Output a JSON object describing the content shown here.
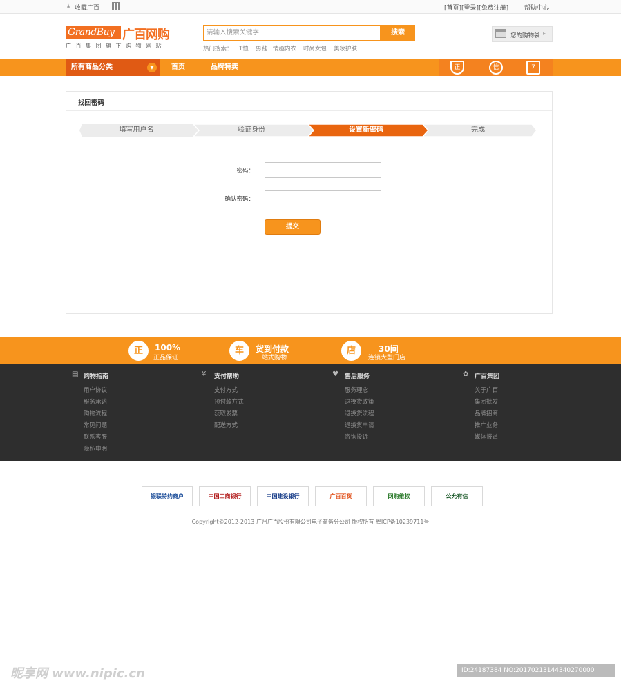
{
  "topbar": {
    "favorite": "收藏广百",
    "links": [
      "[首页]",
      "[登录]",
      "[免费注册]"
    ],
    "help": "帮助中心"
  },
  "logo": {
    "en": "GrandBuy",
    "cn": "广百网购",
    "sub": "广百集团旗下购物网站"
  },
  "search": {
    "placeholder": "请输入搜索关键字",
    "button": "搜索",
    "hot_label": "热门搜索：",
    "hot_terms": [
      "T恤",
      "男鞋",
      "情趣内衣",
      "时尚女包",
      "美妆护肤"
    ]
  },
  "cart": {
    "label": "您的购物袋"
  },
  "nav": {
    "category": "所有商品分类",
    "items": [
      "首页",
      "品牌特卖"
    ],
    "badges": [
      "正",
      "信",
      "7"
    ]
  },
  "panel": {
    "title": "找回密码",
    "steps": [
      "填写用户名",
      "验证身份",
      "设置新密码",
      "完成"
    ],
    "active_step_index": 2,
    "fields": [
      {
        "label": "密码：",
        "value": ""
      },
      {
        "label": "确认密码：",
        "value": ""
      }
    ],
    "submit": "提交"
  },
  "guarantees": [
    {
      "icon": "正",
      "big": "100%",
      "small": "正品保证"
    },
    {
      "icon": "车",
      "big": "货到付款",
      "small": "一站式购物"
    },
    {
      "icon": "店",
      "big": "30间",
      "small": "连锁大型门店"
    }
  ],
  "footer": {
    "columns": [
      {
        "icon": "▤",
        "title": "购物指南",
        "links": [
          "用户协议",
          "服务承诺",
          "购物流程",
          "常见问题",
          "联系客服",
          "隐私申明"
        ]
      },
      {
        "icon": "¥",
        "title": "支付帮助",
        "links": [
          "支付方式",
          "预付款方式",
          "获取发票",
          "配送方式"
        ]
      },
      {
        "icon": "♥",
        "title": "售后服务",
        "links": [
          "服务理念",
          "退换货政策",
          "退换货流程",
          "退换货申请",
          "咨询投诉"
        ]
      },
      {
        "icon": "✿",
        "title": "广百集团",
        "links": [
          "关于广百",
          "集团批发",
          "品牌招商",
          "推广业务",
          "媒体报道"
        ]
      }
    ]
  },
  "partners": [
    "银联特约商户",
    "中国工商银行",
    "中国建设银行",
    "广百百货",
    "网购维权",
    "公允有信"
  ],
  "copyright": "Copyright©2012-2013 广州广百股份有限公司电子商务分公司 版权所有 粤ICP备10239711号",
  "watermark": {
    "left": "昵享网 www.nipic.cn",
    "right": "ID:24187384 NO:20170213144340270000"
  },
  "colors": {
    "accent": "#f7941d",
    "accent_dark": "#e05a14",
    "footer_bg": "#2e2e2e"
  }
}
